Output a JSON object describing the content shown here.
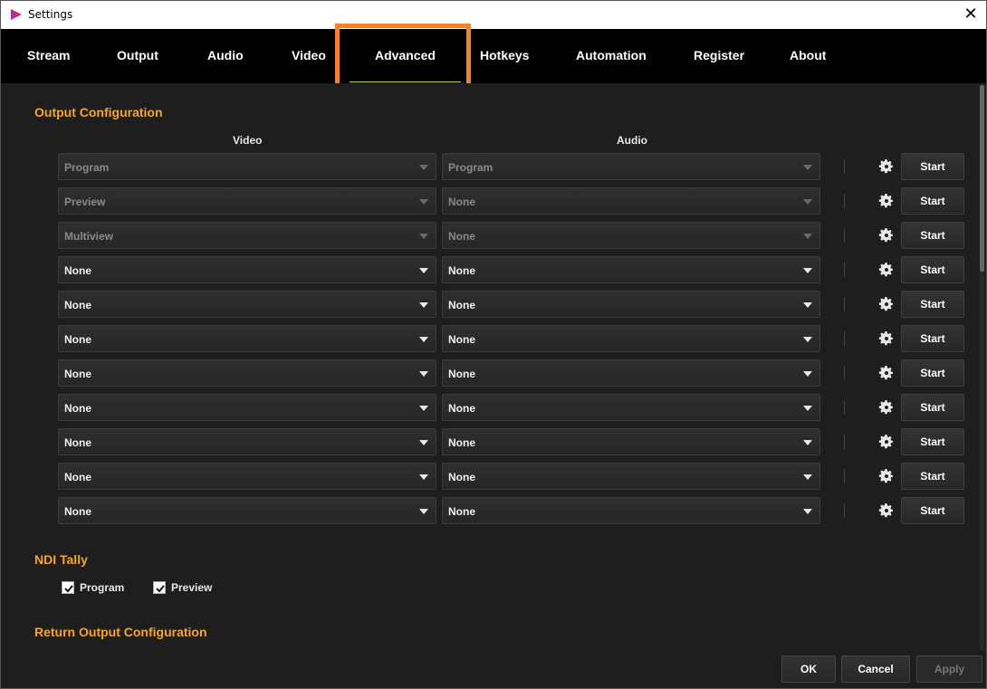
{
  "window": {
    "title": "Settings",
    "close_glyph": "✕",
    "app_icon": "app-logo-icon"
  },
  "tabs": [
    {
      "label": "Stream"
    },
    {
      "label": "Output"
    },
    {
      "label": "Audio"
    },
    {
      "label": "Video"
    },
    {
      "label": "Advanced",
      "active": true
    },
    {
      "label": "Hotkeys"
    },
    {
      "label": "Automation"
    },
    {
      "label": "Register"
    },
    {
      "label": "About"
    }
  ],
  "output_configuration": {
    "title": "Output Configuration",
    "video_header": "Video",
    "audio_header": "Audio",
    "start_label": "Start",
    "rows": [
      {
        "video": "Program",
        "audio": "Program",
        "disabled": true
      },
      {
        "video": "Preview",
        "audio": "None",
        "disabled": true
      },
      {
        "video": "Multiview",
        "audio": "None",
        "disabled": true
      },
      {
        "video": "None",
        "audio": "None",
        "disabled": false
      },
      {
        "video": "None",
        "audio": "None",
        "disabled": false
      },
      {
        "video": "None",
        "audio": "None",
        "disabled": false
      },
      {
        "video": "None",
        "audio": "None",
        "disabled": false
      },
      {
        "video": "None",
        "audio": "None",
        "disabled": false
      },
      {
        "video": "None",
        "audio": "None",
        "disabled": false
      },
      {
        "video": "None",
        "audio": "None",
        "disabled": false
      },
      {
        "video": "None",
        "audio": "None",
        "disabled": false
      }
    ]
  },
  "ndi_tally": {
    "title": "NDI Tally",
    "program": {
      "label": "Program",
      "checked": true
    },
    "preview": {
      "label": "Preview",
      "checked": true
    }
  },
  "return_output": {
    "title": "Return Output Configuration"
  },
  "footer": {
    "ok": "OK",
    "cancel": "Cancel",
    "apply": "Apply"
  },
  "colors": {
    "accent": "#f5a623",
    "highlight": "#f5822a",
    "tab_underline": "#c8d63a",
    "background": "#1e1e1e"
  }
}
